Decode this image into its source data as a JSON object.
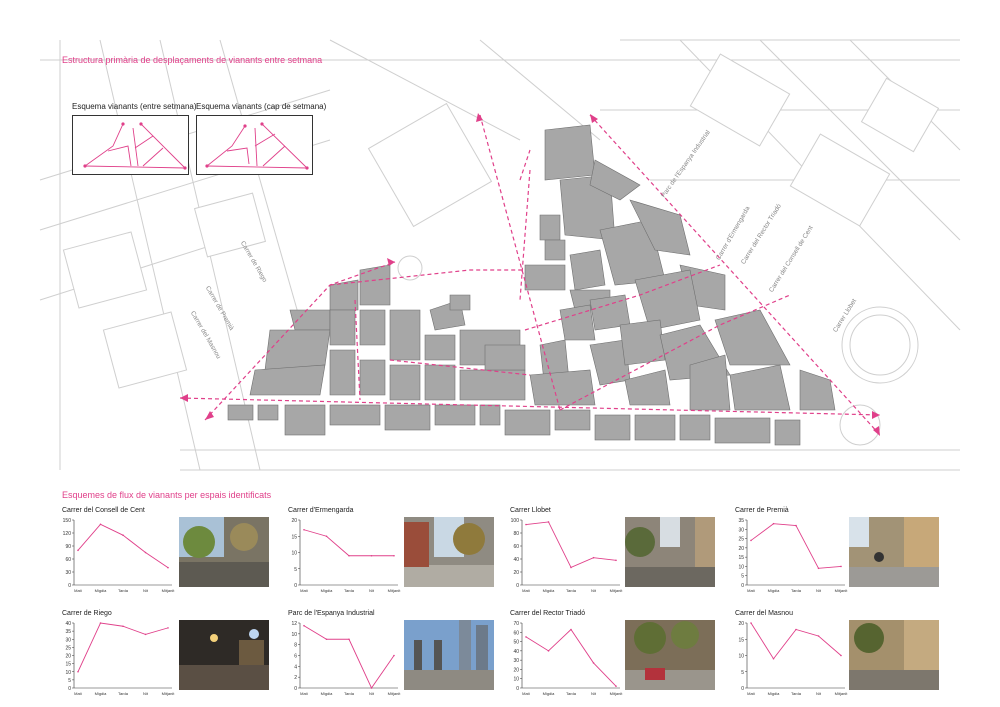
{
  "header": {
    "map_title": "Estructura primària de desplaçaments de vianants entre setmana",
    "charts_title": "Esquemes de flux de vianants per espais identificats"
  },
  "schemas": [
    {
      "label": "Esquema vianants (entre setmana)"
    },
    {
      "label": "Esquema vianants (cap de setmana)"
    }
  ],
  "streets": [
    {
      "name": "Parc de l'Espanya Industrial"
    },
    {
      "name": "Carrer d'Ermengarda"
    },
    {
      "name": "Carrer del Rector Triadó"
    },
    {
      "name": "Carrer del Consell de Cent"
    },
    {
      "name": "Carrer Llobet"
    },
    {
      "name": "Carrer de Riego"
    },
    {
      "name": "Carrer de Premià"
    },
    {
      "name": "Carrer del Masnou"
    }
  ],
  "colors": {
    "accent": "#e0408a",
    "block_fill": "#a7a7a7",
    "street_line": "#c8c8c8"
  },
  "time_labels": [
    "Matí",
    "Migdia",
    "Tarda",
    "Nit",
    "Mitjanit"
  ],
  "chart_data": [
    {
      "type": "line",
      "title": "Carrer del Consell de Cent",
      "x": [
        "Matí",
        "Migdia",
        "Tarda",
        "Nit",
        "Mitjanit"
      ],
      "values": [
        80,
        140,
        115,
        75,
        40
      ],
      "ylim": [
        0,
        150
      ],
      "yticks": [
        0,
        30,
        60,
        90,
        120,
        150
      ]
    },
    {
      "type": "line",
      "title": "Carrer d'Ermengarda",
      "x": [
        "Matí",
        "Migdia",
        "Tarda",
        "Nit",
        "Mitjanit"
      ],
      "values": [
        17,
        15,
        9,
        9,
        9
      ],
      "ylim": [
        0,
        20
      ],
      "yticks": [
        0,
        5,
        10,
        15,
        20
      ]
    },
    {
      "type": "line",
      "title": "Carrer Llobet",
      "x": [
        "Matí",
        "Migdia",
        "Tarda",
        "Nit",
        "Mitjanit"
      ],
      "values": [
        93,
        97,
        27,
        42,
        38
      ],
      "ylim": [
        0,
        100
      ],
      "yticks": [
        0,
        20,
        40,
        60,
        80,
        100
      ]
    },
    {
      "type": "line",
      "title": "Carrer de Premià",
      "x": [
        "Matí",
        "Migdia",
        "Tarda",
        "Nit",
        "Mitjanit"
      ],
      "values": [
        24,
        33,
        32,
        9,
        10
      ],
      "ylim": [
        0,
        35
      ],
      "yticks": [
        0,
        5,
        10,
        15,
        20,
        25,
        30,
        35
      ]
    },
    {
      "type": "line",
      "title": "Carrer de Riego",
      "x": [
        "Matí",
        "Migdia",
        "Tarda",
        "Nit",
        "Mitjanit"
      ],
      "values": [
        10,
        40,
        38,
        33,
        37
      ],
      "ylim": [
        0,
        40
      ],
      "yticks": [
        0,
        5,
        10,
        15,
        20,
        25,
        30,
        35,
        40
      ]
    },
    {
      "type": "line",
      "title": "Parc de l'Espanya Industrial",
      "x": [
        "Matí",
        "Migdia",
        "Tarda",
        "Nit",
        "Mitjanit"
      ],
      "values": [
        11.5,
        9,
        9,
        0,
        6
      ],
      "ylim": [
        0,
        12
      ],
      "yticks": [
        0,
        2,
        4,
        6,
        8,
        10,
        12
      ]
    },
    {
      "type": "line",
      "title": "Carrer del Rector Triadó",
      "x": [
        "Matí",
        "Migdia",
        "Tarda",
        "Nit",
        "Mitjanit"
      ],
      "values": [
        55,
        40,
        63,
        27,
        2
      ],
      "ylim": [
        0,
        70
      ],
      "yticks": [
        0,
        10,
        20,
        30,
        40,
        50,
        60,
        70
      ]
    },
    {
      "type": "line",
      "title": "Carrer del Masnou",
      "x": [
        "Matí",
        "Migdia",
        "Tarda",
        "Nit",
        "Mitjanit"
      ],
      "values": [
        20,
        9,
        18,
        16,
        10
      ],
      "ylim": [
        0,
        20
      ],
      "yticks": [
        0,
        5,
        10,
        15,
        20
      ]
    }
  ]
}
